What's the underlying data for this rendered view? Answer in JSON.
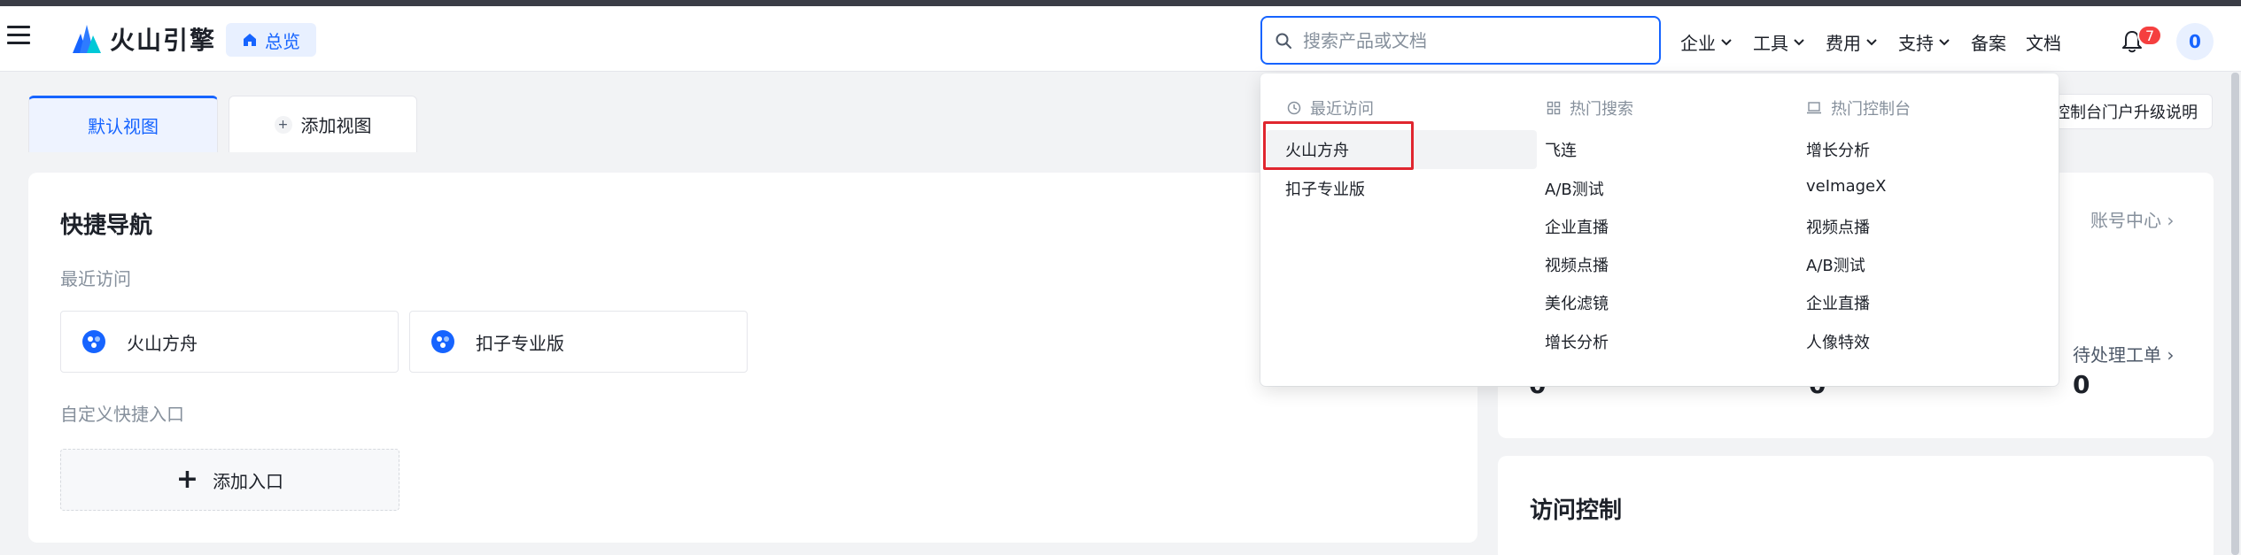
{
  "header": {
    "brand": "火山引擎",
    "overview_label": "总览",
    "search_placeholder": "搜索产品或文档",
    "nav": [
      {
        "label": "企业",
        "has_dropdown": true
      },
      {
        "label": "工具",
        "has_dropdown": true
      },
      {
        "label": "费用",
        "has_dropdown": true
      },
      {
        "label": "支持",
        "has_dropdown": true
      },
      {
        "label": "备案",
        "has_dropdown": false
      },
      {
        "label": "文档",
        "has_dropdown": false
      }
    ],
    "notification_count": "7",
    "avatar_initial": "0"
  },
  "tabs": {
    "default_view": "默认视图",
    "add_view": "添加视图"
  },
  "upgrade_button": "控制台门户升级说明",
  "quick_nav": {
    "title": "快捷导航",
    "recent_label": "最近访问",
    "recent_items": [
      "火山方舟",
      "扣子专业版"
    ],
    "custom_label": "自定义快捷入口",
    "add_entry": "添加入口"
  },
  "account_card": {
    "account_center_link": "账号中心",
    "pending_tickets_link": "待处理工单",
    "stats": [
      "0",
      "0",
      "0"
    ]
  },
  "access_control": {
    "title": "访问控制"
  },
  "search_dropdown": {
    "recent": {
      "title": "最近访问",
      "items": [
        "火山方舟",
        "扣子专业版"
      ]
    },
    "hot_search": {
      "title": "热门搜索",
      "items": [
        "飞连",
        "A/B测试",
        "企业直播",
        "视频点播",
        "美化滤镜",
        "增长分析"
      ]
    },
    "hot_console": {
      "title": "热门控制台",
      "items": [
        "增长分析",
        "veImageX",
        "视频点播",
        "A/B测试",
        "企业直播",
        "人像特效"
      ]
    }
  },
  "colors": {
    "accent": "#1664ff",
    "highlight_box": "#e0262f",
    "badge": "#f53f3f"
  }
}
